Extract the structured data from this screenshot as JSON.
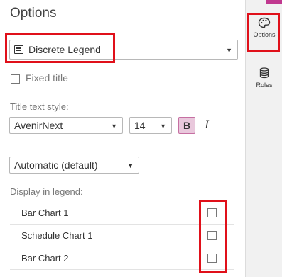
{
  "panel": {
    "title": "Options",
    "legend_type": {
      "selected": "Discrete Legend"
    },
    "fixed_title": {
      "label": "Fixed title",
      "checked": false
    },
    "title_text_style": {
      "label": "Title text style:",
      "font": "AvenirNext",
      "size": "14",
      "bold_label": "B",
      "bold_active": true,
      "italic_label": "I"
    },
    "position_select": {
      "selected": "Automatic (default)"
    },
    "display_in_legend": {
      "label": "Display in legend:",
      "items": [
        {
          "label": "Bar Chart 1",
          "checked": false
        },
        {
          "label": "Schedule Chart 1",
          "checked": false
        },
        {
          "label": "Bar Chart 2",
          "checked": false
        }
      ]
    }
  },
  "rail": {
    "items": [
      {
        "label": "Options",
        "icon": "paint-palette-icon",
        "active": true
      },
      {
        "label": "Roles",
        "icon": "database-icon",
        "active": false
      }
    ]
  },
  "colors": {
    "accent": "#c0388f",
    "highlight": "#e0101a",
    "bold_active_bg": "#e9c8dc"
  }
}
